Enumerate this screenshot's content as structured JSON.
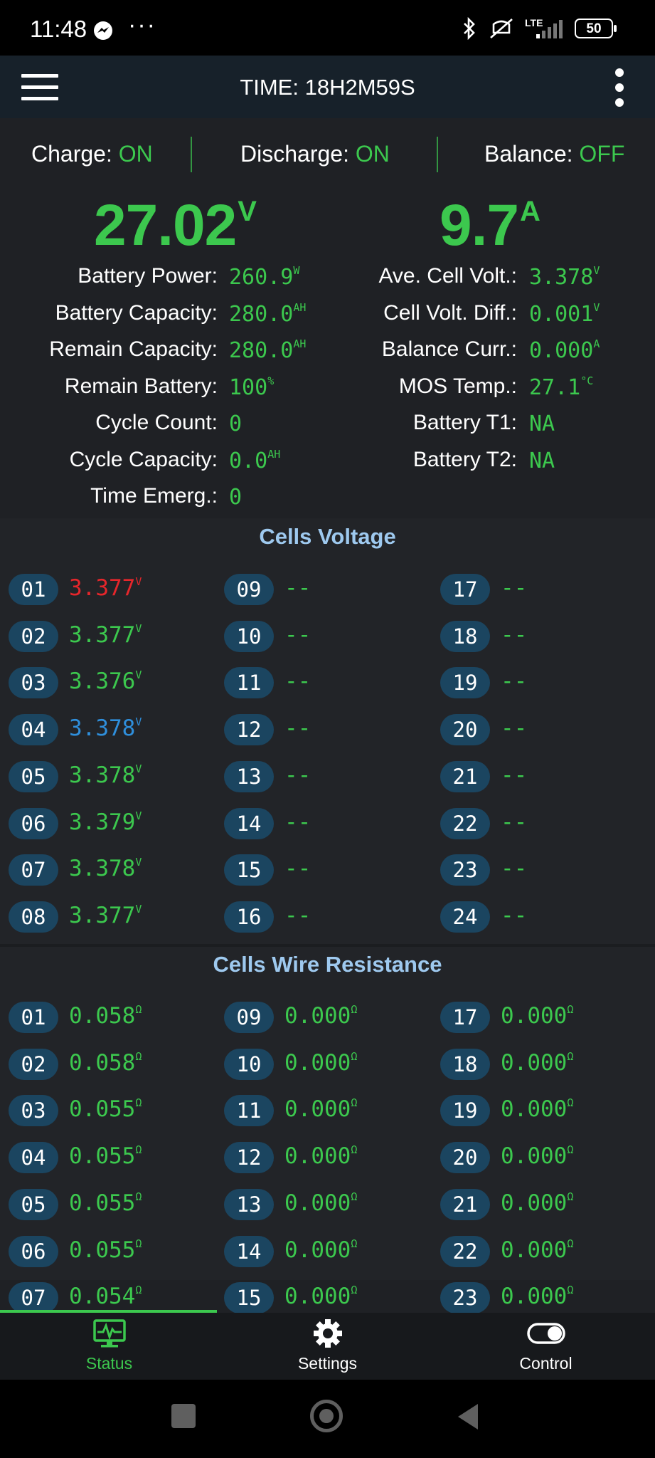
{
  "status_bar": {
    "time": "11:48",
    "dots": "···",
    "network": "LTE",
    "battery": "50"
  },
  "toolbar": {
    "title": "TIME: 18H2M59S"
  },
  "switches": {
    "charge": {
      "label": "Charge:",
      "value": "ON"
    },
    "discharge": {
      "label": "Discharge:",
      "value": "ON"
    },
    "balance": {
      "label": "Balance:",
      "value": "OFF"
    }
  },
  "totals": {
    "voltage": "27.02",
    "voltage_unit": "V",
    "current": "9.7",
    "current_unit": "A"
  },
  "stats_left": [
    {
      "label": "Battery Power:",
      "value": "260.9",
      "unit": "W"
    },
    {
      "label": "Battery Capacity:",
      "value": "280.0",
      "unit": "AH"
    },
    {
      "label": "Remain Capacity:",
      "value": "280.0",
      "unit": "AH"
    },
    {
      "label": "Remain Battery:",
      "value": "100",
      "unit": "%"
    },
    {
      "label": "Cycle Count:",
      "value": "0",
      "unit": ""
    },
    {
      "label": "Cycle Capacity:",
      "value": "0.0",
      "unit": "AH"
    },
    {
      "label": "Time Emerg.:",
      "value": "0",
      "unit": ""
    }
  ],
  "stats_right": [
    {
      "label": "Ave. Cell Volt.:",
      "value": "3.378",
      "unit": "V"
    },
    {
      "label": "Cell Volt. Diff.:",
      "value": "0.001",
      "unit": "V"
    },
    {
      "label": "Balance Curr.:",
      "value": "0.000",
      "unit": "A"
    },
    {
      "label": "MOS Temp.:",
      "value": "27.1",
      "unit": "°C"
    },
    {
      "label": "Battery T1:",
      "value": "NA",
      "unit": ""
    },
    {
      "label": "Battery T2:",
      "value": "NA",
      "unit": ""
    }
  ],
  "cells_voltage": {
    "title": "Cells Voltage",
    "unit": "V",
    "colors": {
      "normal": "#3cc84e",
      "min": "#e6262b",
      "max": "#2f8fdc"
    },
    "cells": [
      {
        "id": "01",
        "value": "3.377",
        "state": "min"
      },
      {
        "id": "02",
        "value": "3.377",
        "state": "normal"
      },
      {
        "id": "03",
        "value": "3.376",
        "state": "normal"
      },
      {
        "id": "04",
        "value": "3.378",
        "state": "max"
      },
      {
        "id": "05",
        "value": "3.378",
        "state": "normal"
      },
      {
        "id": "06",
        "value": "3.379",
        "state": "normal"
      },
      {
        "id": "07",
        "value": "3.378",
        "state": "normal"
      },
      {
        "id": "08",
        "value": "3.377",
        "state": "normal"
      },
      {
        "id": "09",
        "value": "--",
        "state": "empty"
      },
      {
        "id": "10",
        "value": "--",
        "state": "empty"
      },
      {
        "id": "11",
        "value": "--",
        "state": "empty"
      },
      {
        "id": "12",
        "value": "--",
        "state": "empty"
      },
      {
        "id": "13",
        "value": "--",
        "state": "empty"
      },
      {
        "id": "14",
        "value": "--",
        "state": "empty"
      },
      {
        "id": "15",
        "value": "--",
        "state": "empty"
      },
      {
        "id": "16",
        "value": "--",
        "state": "empty"
      },
      {
        "id": "17",
        "value": "--",
        "state": "empty"
      },
      {
        "id": "18",
        "value": "--",
        "state": "empty"
      },
      {
        "id": "19",
        "value": "--",
        "state": "empty"
      },
      {
        "id": "20",
        "value": "--",
        "state": "empty"
      },
      {
        "id": "21",
        "value": "--",
        "state": "empty"
      },
      {
        "id": "22",
        "value": "--",
        "state": "empty"
      },
      {
        "id": "23",
        "value": "--",
        "state": "empty"
      },
      {
        "id": "24",
        "value": "--",
        "state": "empty"
      }
    ]
  },
  "cells_resistance": {
    "title": "Cells Wire Resistance",
    "unit": "Ω",
    "cells": [
      {
        "id": "01",
        "value": "0.058"
      },
      {
        "id": "02",
        "value": "0.058"
      },
      {
        "id": "03",
        "value": "0.055"
      },
      {
        "id": "04",
        "value": "0.055"
      },
      {
        "id": "05",
        "value": "0.055"
      },
      {
        "id": "06",
        "value": "0.055"
      },
      {
        "id": "07",
        "value": "0.054"
      },
      {
        "id": "09",
        "value": "0.000"
      },
      {
        "id": "10",
        "value": "0.000"
      },
      {
        "id": "11",
        "value": "0.000"
      },
      {
        "id": "12",
        "value": "0.000"
      },
      {
        "id": "13",
        "value": "0.000"
      },
      {
        "id": "14",
        "value": "0.000"
      },
      {
        "id": "15",
        "value": "0.000"
      },
      {
        "id": "17",
        "value": "0.000"
      },
      {
        "id": "18",
        "value": "0.000"
      },
      {
        "id": "19",
        "value": "0.000"
      },
      {
        "id": "20",
        "value": "0.000"
      },
      {
        "id": "21",
        "value": "0.000"
      },
      {
        "id": "22",
        "value": "0.000"
      },
      {
        "id": "23",
        "value": "0.000"
      }
    ]
  },
  "bottom_nav": {
    "active": "status",
    "active_color": "#3cc84e",
    "items": [
      {
        "key": "status",
        "label": "Status",
        "icon": "monitor-pulse-icon"
      },
      {
        "key": "settings",
        "label": "Settings",
        "icon": "gear-icon"
      },
      {
        "key": "control",
        "label": "Control",
        "icon": "toggle-icon"
      }
    ]
  }
}
